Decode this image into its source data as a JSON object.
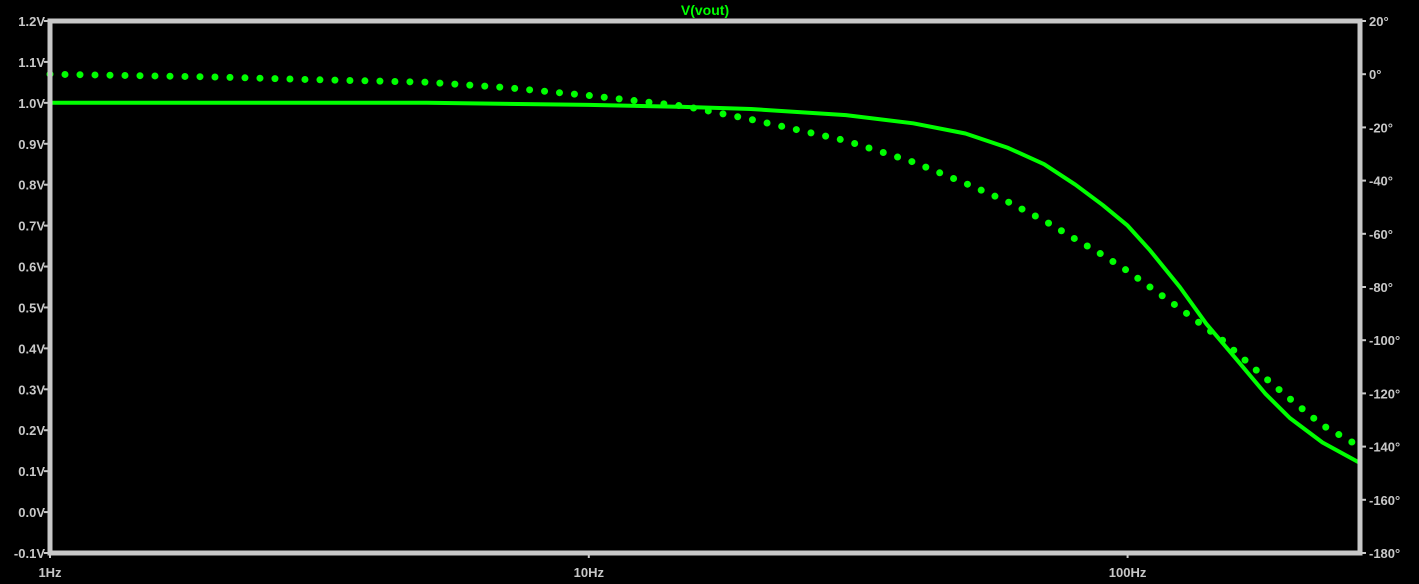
{
  "chart_data": {
    "type": "line",
    "title": "V(vout)",
    "x_scale": "log",
    "xlim": [
      1,
      270
    ],
    "ylim": [
      -0.1,
      1.2
    ],
    "y2lim": [
      -180,
      20
    ],
    "x_ticks": [
      {
        "value": 1,
        "label": "1Hz"
      },
      {
        "value": 10,
        "label": "10Hz"
      },
      {
        "value": 100,
        "label": "100Hz"
      }
    ],
    "y_ticks": [
      {
        "value": 1.2,
        "label": "1.2V"
      },
      {
        "value": 1.1,
        "label": "1.1V"
      },
      {
        "value": 1.0,
        "label": "1.0V"
      },
      {
        "value": 0.9,
        "label": "0.9V"
      },
      {
        "value": 0.8,
        "label": "0.8V"
      },
      {
        "value": 0.7,
        "label": "0.7V"
      },
      {
        "value": 0.6,
        "label": "0.6V"
      },
      {
        "value": 0.5,
        "label": "0.5V"
      },
      {
        "value": 0.4,
        "label": "0.4V"
      },
      {
        "value": 0.3,
        "label": "0.3V"
      },
      {
        "value": 0.2,
        "label": "0.2V"
      },
      {
        "value": 0.1,
        "label": "0.1V"
      },
      {
        "value": 0.0,
        "label": "0.0V"
      },
      {
        "value": -0.1,
        "label": "-0.1V"
      }
    ],
    "y2_ticks": [
      {
        "value": 20,
        "label": "20°"
      },
      {
        "value": 0,
        "label": "0°"
      },
      {
        "value": -20,
        "label": "-20°"
      },
      {
        "value": -40,
        "label": "-40°"
      },
      {
        "value": -60,
        "label": "-60°"
      },
      {
        "value": -80,
        "label": "-80°"
      },
      {
        "value": -100,
        "label": "-100°"
      },
      {
        "value": -120,
        "label": "-120°"
      },
      {
        "value": -140,
        "label": "-140°"
      },
      {
        "value": -160,
        "label": "-160°"
      },
      {
        "value": -180,
        "label": "-180°"
      }
    ],
    "series": [
      {
        "axis": "left",
        "style": "solid",
        "color": "#00ff00",
        "x": [
          1,
          2,
          5,
          10,
          15,
          20,
          30,
          40,
          50,
          60,
          70,
          80,
          90,
          100,
          110,
          125,
          140,
          160,
          180,
          200,
          230,
          270
        ],
        "y": [
          1.0,
          1.0,
          1.0,
          0.995,
          0.99,
          0.985,
          0.97,
          0.95,
          0.925,
          0.89,
          0.85,
          0.8,
          0.75,
          0.7,
          0.64,
          0.55,
          0.46,
          0.37,
          0.29,
          0.23,
          0.17,
          0.12
        ]
      },
      {
        "axis": "right",
        "style": "dotted",
        "color": "#00ff00",
        "x": [
          1,
          2,
          3,
          5,
          7,
          10,
          15,
          20,
          30,
          40,
          50,
          60,
          70,
          80,
          90,
          100,
          110,
          125,
          150,
          175,
          200,
          230,
          270
        ],
        "y": [
          0,
          -1,
          -2,
          -3,
          -5,
          -8,
          -12,
          -17,
          -25,
          -33,
          -41,
          -48,
          -55,
          -62,
          -68,
          -74,
          -80,
          -88,
          -100,
          -112,
          -122,
          -132,
          -140
        ]
      }
    ]
  }
}
